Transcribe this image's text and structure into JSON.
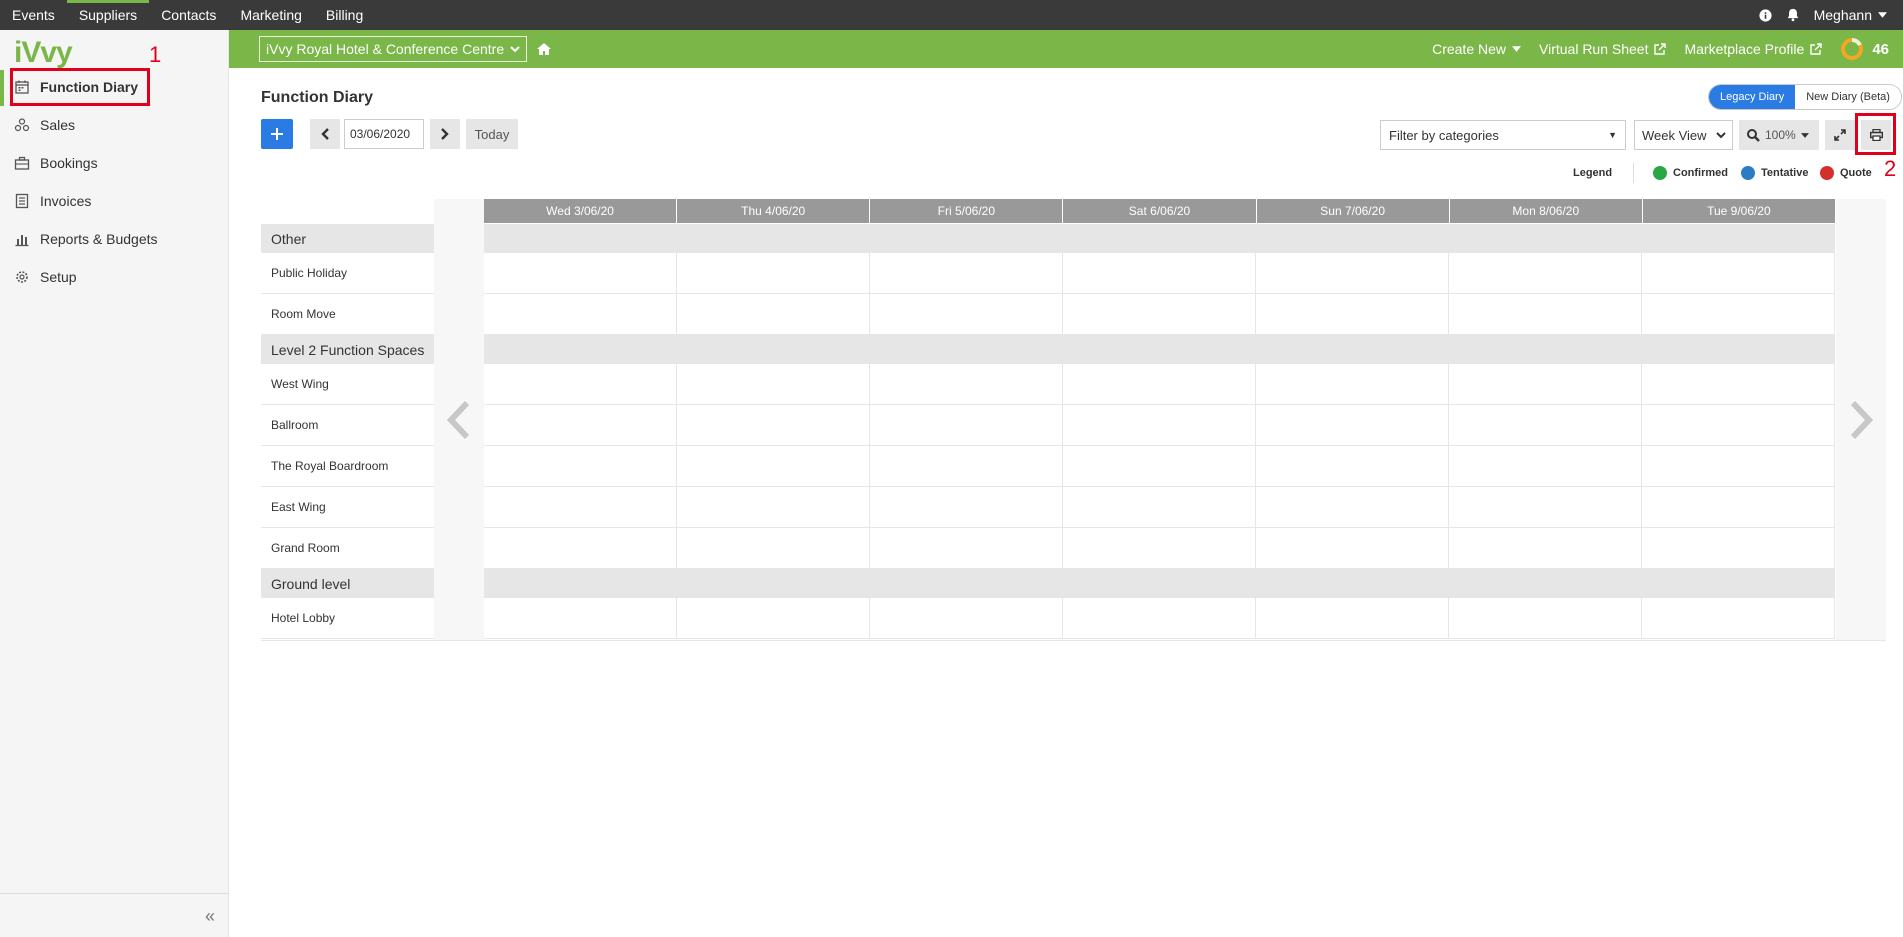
{
  "topnav": {
    "items": [
      "Events",
      "Suppliers",
      "Contacts",
      "Marketing",
      "Billing"
    ],
    "user": "Meghann"
  },
  "sidebar": {
    "logo": "iVvy",
    "items": [
      "Function Diary",
      "Sales",
      "Bookings",
      "Invoices",
      "Reports & Budgets",
      "Setup"
    ]
  },
  "greenbar": {
    "venue": "iVvy Royal Hotel & Conference Centre",
    "create_new": "Create New",
    "run_sheet": "Virtual Run Sheet",
    "marketplace": "Marketplace Profile",
    "score": "46"
  },
  "main": {
    "title": "Function Diary",
    "toggle": [
      "Legacy Diary",
      "New Diary (Beta)"
    ],
    "date": "03/06/2020",
    "today": "Today",
    "filter_placeholder": "Filter by categories",
    "view": "Week View",
    "zoom": "100%"
  },
  "legend": {
    "title": "Legend",
    "items": [
      {
        "label": "Confirmed",
        "color": "#27a845"
      },
      {
        "label": "Tentative",
        "color": "#2d7bc4"
      },
      {
        "label": "Quote",
        "color": "#d32f2f"
      }
    ]
  },
  "days": [
    "Wed 3/06/20",
    "Thu 4/06/20",
    "Fri 5/06/20",
    "Sat 6/06/20",
    "Sun 7/06/20",
    "Mon 8/06/20",
    "Tue 9/06/20"
  ],
  "groups": [
    {
      "name": "Other",
      "rooms": [
        "Public Holiday",
        "Room Move"
      ]
    },
    {
      "name": "Level 2 Function Spaces",
      "rooms": [
        "West Wing",
        "Ballroom",
        "The Royal Boardroom",
        "East Wing",
        "Grand Room"
      ]
    },
    {
      "name": "Ground level",
      "rooms": [
        "Hotel Lobby"
      ]
    }
  ],
  "annotations": [
    "1",
    "2"
  ]
}
